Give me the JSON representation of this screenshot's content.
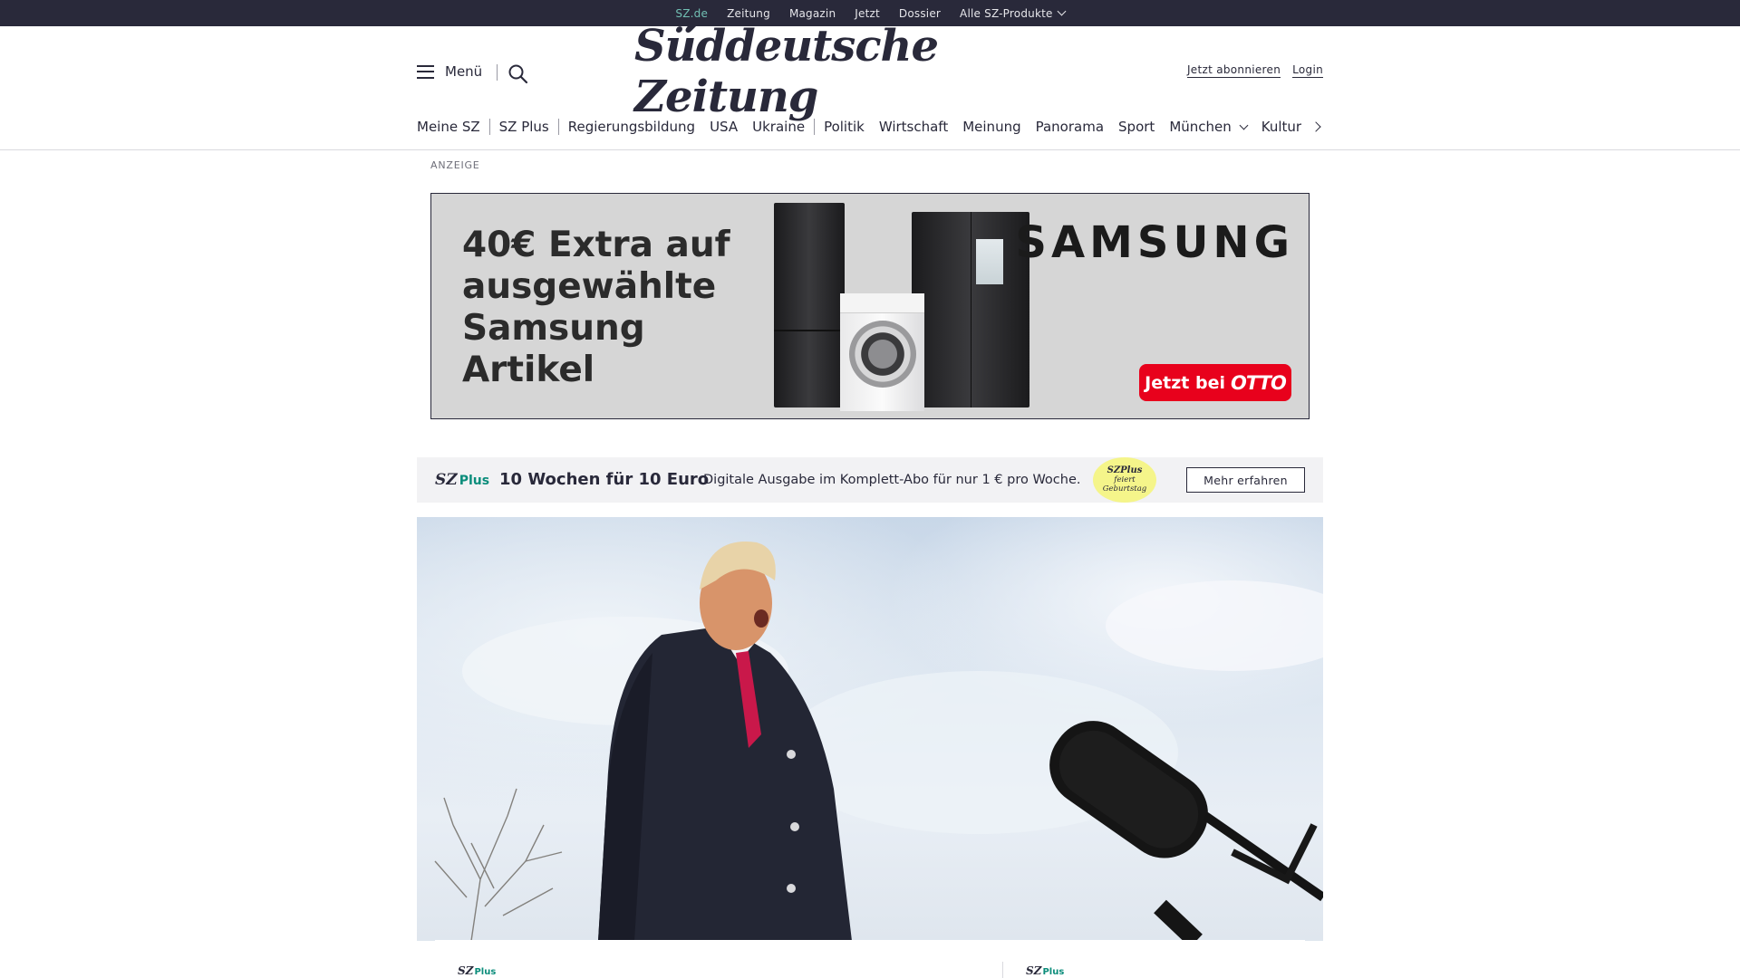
{
  "topbar": {
    "links": [
      "SZ.de",
      "Zeitung",
      "Magazin",
      "Jetzt",
      "Dossier",
      "Alle SZ-Produkte"
    ],
    "active": "SZ.de"
  },
  "header": {
    "menu_label": "Menü",
    "logo_text": "Süddeutsche Zeitung",
    "subscribe_label": "Jetzt abonnieren",
    "login_label": "Login"
  },
  "ressorts": [
    "Meine SZ",
    "SZ Plus",
    "Regierungsbildung",
    "USA",
    "Ukraine",
    "Politik",
    "Wirtschaft",
    "Meinung",
    "Panorama",
    "Sport",
    "München",
    "Kultur"
  ],
  "ad": {
    "label": "ANZEIGE",
    "headline": "40€ Extra auf ausgewählte Samsung Artikel",
    "brand": "SAMSUNG",
    "cta_prefix": "Jetzt bei",
    "cta_brand": "OTTO"
  },
  "promo": {
    "logo_sz": "SZ",
    "logo_plus": "Plus",
    "title": "10 Wochen für 10 Euro",
    "text": "Digitale Ausgabe im Komplett-Abo für nur 1 € pro Woche.",
    "badge_line1": "SZPlus",
    "badge_line2": "feiert",
    "badge_line3": "Geburtstag",
    "button": "Mehr erfahren"
  },
  "teasers": [
    {
      "kicker_sz": "SZ",
      "kicker_plus": "Plus"
    },
    {
      "kicker_sz": "SZ",
      "kicker_plus": "Plus"
    }
  ],
  "colors": {
    "brand_dark": "#29293a",
    "accent_teal": "#71c0b4",
    "plus_green": "#0b8d7b",
    "otto_red": "#e8011c",
    "badge_yellow": "#f5f58a"
  },
  "icons": {
    "menu": "hamburger-icon",
    "search": "search-icon",
    "dropdown": "chevron-down-icon",
    "next": "chevron-right-icon"
  }
}
